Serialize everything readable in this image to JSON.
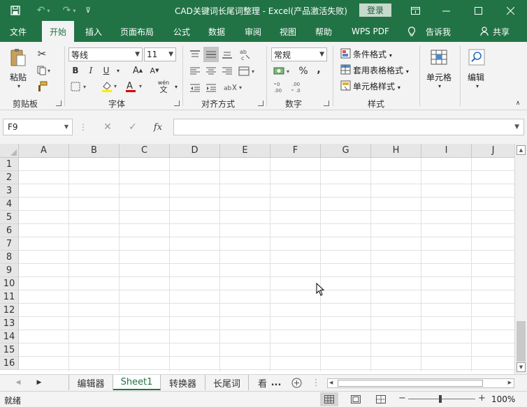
{
  "window": {
    "title": "CAD关键词长尾词整理  -  Excel(产品激活失败)",
    "login_label": "登录"
  },
  "tabs": [
    "文件",
    "开始",
    "插入",
    "页面布局",
    "公式",
    "数据",
    "审阅",
    "视图",
    "帮助",
    "WPS PDF",
    "告诉我",
    "共享"
  ],
  "active_tab": "开始",
  "ribbon": {
    "clipboard": {
      "paste_label": "粘贴",
      "group_label": "剪贴板"
    },
    "font": {
      "font_name": "等线",
      "font_size": "11",
      "group_label": "字体",
      "bold": "B",
      "italic": "I",
      "underline": "U",
      "wen": "wén",
      "wen_char": "文"
    },
    "alignment": {
      "group_label": "对齐方式"
    },
    "number": {
      "format": "常规",
      "percent": "%",
      "comma": ",",
      "group_label": "数字"
    },
    "styles": {
      "conditional": "条件格式",
      "table_format": "套用表格格式",
      "cell_styles": "单元格样式",
      "group_label": "样式"
    },
    "cells": {
      "label": "单元格"
    },
    "editing": {
      "label": "编辑"
    }
  },
  "formula_bar": {
    "name_box": "F9",
    "fx": "fx",
    "value": ""
  },
  "grid": {
    "columns": [
      "A",
      "B",
      "C",
      "D",
      "E",
      "F",
      "G",
      "H",
      "I",
      "J"
    ],
    "rows": [
      "1",
      "2",
      "3",
      "4",
      "5",
      "6",
      "7",
      "8",
      "9",
      "10",
      "11",
      "12",
      "13",
      "14",
      "15",
      "16"
    ]
  },
  "sheets": {
    "tabs": [
      "编辑器",
      "Sheet1",
      "转换器",
      "长尾词",
      "看"
    ],
    "active": "Sheet1",
    "more": "..."
  },
  "status": {
    "ready": "就绪",
    "zoom": "100%"
  },
  "colors": {
    "brand": "#217346",
    "ribbon_bg": "#f3f3f3"
  }
}
